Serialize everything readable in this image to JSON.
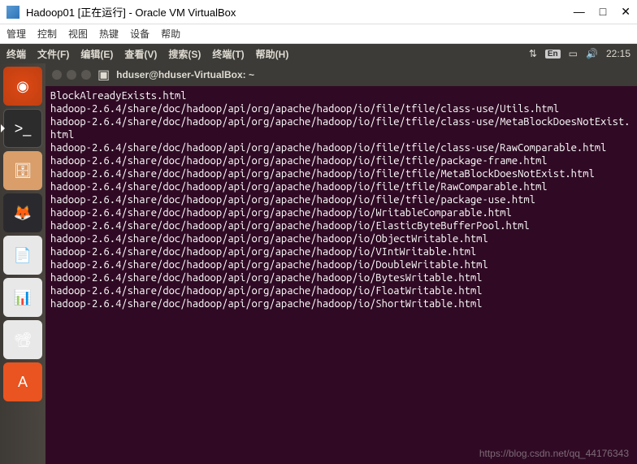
{
  "vbox": {
    "title": "Hadoop01 [正在运行] - Oracle VM VirtualBox",
    "controls": {
      "min": "—",
      "max": "□",
      "close": "✕"
    },
    "menu": [
      "管理",
      "控制",
      "视图",
      "热键",
      "设备",
      "帮助"
    ]
  },
  "ubuntu_topbar": {
    "app": "终端",
    "menus": [
      "文件(F)",
      "编辑(E)",
      "查看(V)",
      "搜索(S)",
      "终端(T)",
      "帮助(H)"
    ],
    "lang_badge": "En",
    "time": "22:15"
  },
  "launcher": [
    {
      "name": "ubuntu-dash",
      "cls": "ubuntu-logo",
      "glyph": "◉"
    },
    {
      "name": "terminal",
      "cls": "terminal-ic",
      "glyph": ">_",
      "active": true
    },
    {
      "name": "files",
      "cls": "files-ic",
      "glyph": "🗄"
    },
    {
      "name": "firefox",
      "cls": "firefox-ic",
      "glyph": "🦊"
    },
    {
      "name": "writer",
      "cls": "writer-ic",
      "glyph": "📄"
    },
    {
      "name": "calc",
      "cls": "calc-ic",
      "glyph": "📊"
    },
    {
      "name": "impress",
      "cls": "impress-ic",
      "glyph": "📽"
    },
    {
      "name": "software",
      "cls": "software-ic",
      "glyph": "A"
    }
  ],
  "terminal": {
    "title": "hduser@hduser-VirtualBox: ~",
    "lines": [
      "BlockAlreadyExists.html",
      "hadoop-2.6.4/share/doc/hadoop/api/org/apache/hadoop/io/file/tfile/class-use/Utils.html",
      "hadoop-2.6.4/share/doc/hadoop/api/org/apache/hadoop/io/file/tfile/class-use/MetaBlockDoesNotExist.html",
      "hadoop-2.6.4/share/doc/hadoop/api/org/apache/hadoop/io/file/tfile/class-use/RawComparable.html",
      "hadoop-2.6.4/share/doc/hadoop/api/org/apache/hadoop/io/file/tfile/package-frame.html",
      "hadoop-2.6.4/share/doc/hadoop/api/org/apache/hadoop/io/file/tfile/MetaBlockDoesNotExist.html",
      "hadoop-2.6.4/share/doc/hadoop/api/org/apache/hadoop/io/file/tfile/RawComparable.html",
      "hadoop-2.6.4/share/doc/hadoop/api/org/apache/hadoop/io/file/tfile/package-use.html",
      "hadoop-2.6.4/share/doc/hadoop/api/org/apache/hadoop/io/WritableComparable.html",
      "hadoop-2.6.4/share/doc/hadoop/api/org/apache/hadoop/io/ElasticByteBufferPool.html",
      "hadoop-2.6.4/share/doc/hadoop/api/org/apache/hadoop/io/ObjectWritable.html",
      "hadoop-2.6.4/share/doc/hadoop/api/org/apache/hadoop/io/VIntWritable.html",
      "hadoop-2.6.4/share/doc/hadoop/api/org/apache/hadoop/io/DoubleWritable.html",
      "hadoop-2.6.4/share/doc/hadoop/api/org/apache/hadoop/io/BytesWritable.html",
      "hadoop-2.6.4/share/doc/hadoop/api/org/apache/hadoop/io/FloatWritable.html",
      "hadoop-2.6.4/share/doc/hadoop/api/org/apache/hadoop/io/ShortWritable.html"
    ]
  },
  "watermark": "https://blog.csdn.net/qq_44176343"
}
